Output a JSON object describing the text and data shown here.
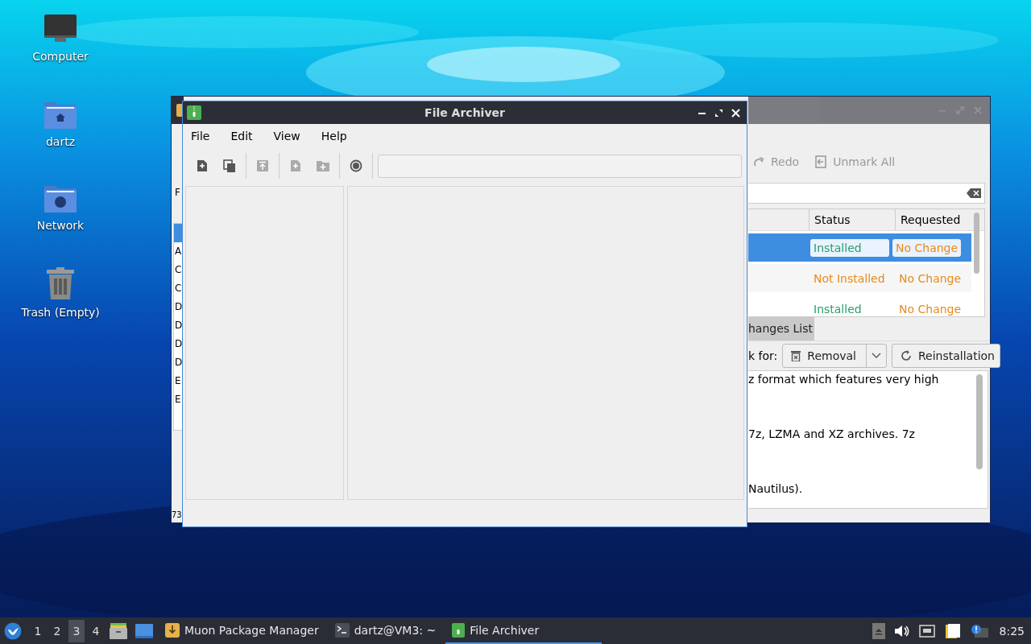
{
  "desktop": {
    "icons": [
      {
        "label": "Computer",
        "kind": "computer"
      },
      {
        "label": "dartz",
        "kind": "home"
      },
      {
        "label": "Network",
        "kind": "network"
      },
      {
        "label": "Trash (Empty)",
        "kind": "trash"
      }
    ]
  },
  "back_window": {
    "menu_letter": "F",
    "list": [
      {
        "selected": true
      },
      {
        "text": "A",
        "selected": false
      },
      {
        "text": "C",
        "selected": false
      },
      {
        "text": "C",
        "selected": false
      },
      {
        "text": "D",
        "selected": false
      },
      {
        "text": "D",
        "selected": false
      },
      {
        "text": "D",
        "selected": false
      },
      {
        "text": "D",
        "selected": false
      },
      {
        "text": "E",
        "selected": false
      },
      {
        "text": "E",
        "selected": false
      }
    ],
    "status_text": "73",
    "toolbar": [
      {
        "label": "Redo",
        "kind": "redo",
        "disabled": true
      },
      {
        "label": "Unmark All",
        "kind": "unmark",
        "disabled": true
      }
    ],
    "table": {
      "columns": [
        "Status",
        "Requested"
      ],
      "rows": [
        {
          "status": "Installed",
          "color": "#27a06a",
          "requested": "No Change",
          "selected": true
        },
        {
          "status": "Not Installed",
          "color": "#e88a1a",
          "requested": "No Change",
          "selected": false
        },
        {
          "status": "Installed",
          "color": "#27a06a",
          "requested": "No Change",
          "selected": false
        }
      ]
    },
    "tab": "hanges List",
    "mark_label": "k for:",
    "buttons": [
      {
        "label": "Removal",
        "kind": "removal",
        "dropdown": true
      },
      {
        "label": "Reinstallation",
        "kind": "reinstall",
        "dropdown": false
      }
    ],
    "description": [
      "z format which features very high",
      "7z, LZMA and XZ archives. 7z",
      "Nautilus)."
    ]
  },
  "window": {
    "title": "File Archiver",
    "menu": [
      "File",
      "Edit",
      "View",
      "Help"
    ],
    "toolbar": [
      {
        "kind": "new",
        "disabled": false
      },
      {
        "kind": "open",
        "disabled": false
      },
      {
        "kind": "extract",
        "disabled": true
      },
      {
        "kind": "add_file",
        "disabled": true
      },
      {
        "kind": "add_folder",
        "disabled": true
      },
      {
        "kind": "stop",
        "disabled": false
      }
    ]
  },
  "taskbar": {
    "workspaces": [
      {
        "label": "1",
        "selected": false
      },
      {
        "label": "2",
        "selected": false
      },
      {
        "label": "3",
        "selected": true
      },
      {
        "label": "4",
        "selected": false
      }
    ],
    "tasks": [
      {
        "label": "Muon Package Manager",
        "kind": "package",
        "selected": false
      },
      {
        "label": "dartz@VM3: ~",
        "kind": "terminal",
        "selected": false
      },
      {
        "label": "File Archiver",
        "kind": "archive",
        "selected": true
      }
    ],
    "clock": "8:25"
  }
}
